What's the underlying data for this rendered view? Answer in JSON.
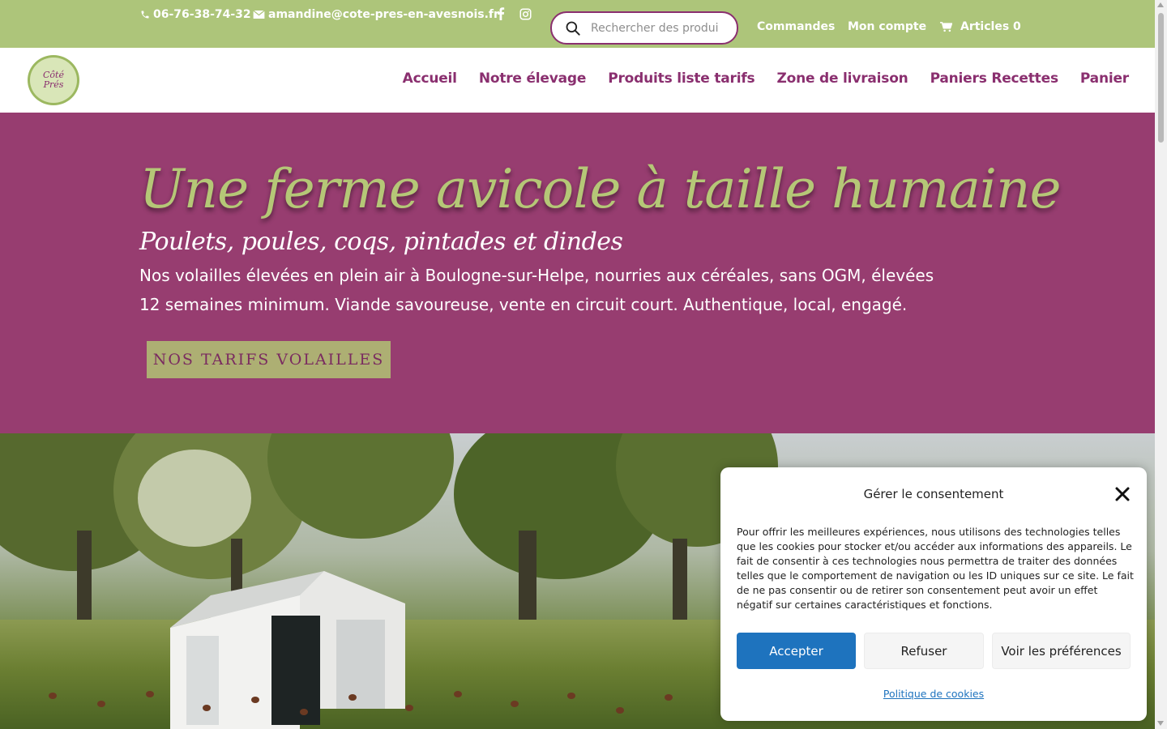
{
  "topbar": {
    "phone": "06-76-38-74-32",
    "email": "amandine@cote-pres-en-avesnois.fr",
    "social": [
      "facebook-icon",
      "instagram-icon"
    ],
    "search_placeholder": "Rechercher des produi",
    "links": [
      "Commandes",
      "Mon compte"
    ],
    "cart_label": "Articles 0"
  },
  "header": {
    "logo_text": [
      "Côté",
      "Prés"
    ],
    "nav": [
      "Accueil",
      "Notre élevage",
      "Produits liste tarifs",
      "Zone de livraison",
      "Paniers Recettes",
      "Panier"
    ]
  },
  "hero": {
    "title": "Une ferme avicole à taille humaine",
    "subtitle": "Poulets, poules, coqs, pintades et dindes",
    "description": "Nos volailles élevées en plein air à Boulogne-sur-Helpe, nourries aux céréales, sans OGM, élevées 12 semaines minimum. Viande savoureuse, vente en circuit court. Authentique, local, engagé.",
    "cta_label": "NOS TARIFS VOLAILLES"
  },
  "consent": {
    "title": "Gérer le consentement",
    "text": "Pour offrir les meilleures expériences, nous utilisons des technologies telles que les cookies pour stocker et/ou accéder aux informations des appareils. Le fait de consentir à ces technologies nous permettra de traiter des données telles que le comportement de navigation ou les ID uniques sur ce site. Le fait de ne pas consentir ou de retirer son consentement peut avoir un effet négatif sur certaines caractéristiques et fonctions.",
    "accept_label": "Accepter",
    "refuse_label": "Refuser",
    "prefs_label": "Voir les préférences",
    "policy_link": "Politique de cookies"
  },
  "colors": {
    "topbar_green": "#adc57a",
    "brand_purple": "#973d70",
    "nav_purple": "#8a2f6f",
    "hero_title_green": "#b5c777",
    "cta_olive": "#adaf73",
    "accept_blue": "#1e73be"
  }
}
